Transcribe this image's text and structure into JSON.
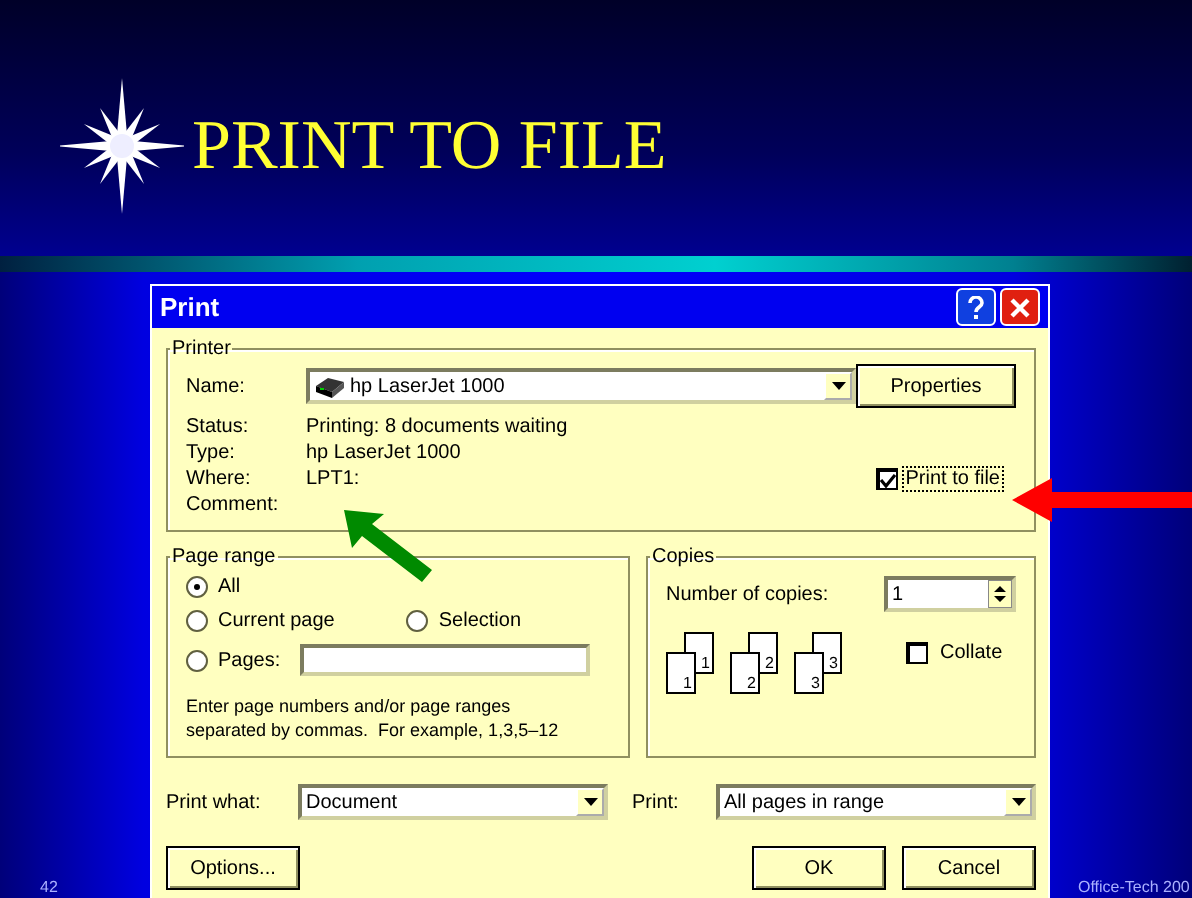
{
  "slide": {
    "title": "PRINT TO FILE",
    "number": "42",
    "footer": "Office-Tech 200"
  },
  "dialog": {
    "title": "Print",
    "printer": {
      "legend": "Printer",
      "name_label": "Name:",
      "name_value": "hp LaserJet 1000",
      "properties_button": "Properties",
      "info": [
        {
          "label": "Status:",
          "value": "Printing: 8 documents waiting"
        },
        {
          "label": "Type:",
          "value": "hp LaserJet 1000"
        },
        {
          "label": "Where:",
          "value": "LPT1:"
        },
        {
          "label": "Comment:"
        }
      ],
      "print_to_file": {
        "label": "Print to file",
        "checked": true
      }
    },
    "page_range": {
      "legend": "Page range",
      "options": [
        {
          "label": "All",
          "selected": true
        },
        {
          "label": "Current page",
          "selected": false
        },
        {
          "label": "Selection",
          "selected": false
        },
        {
          "label": "Pages:",
          "selected": false
        }
      ],
      "hint": "Enter page numbers and/or page ranges\nseparated by commas.  For example, 1,3,5–12"
    },
    "copies": {
      "legend": "Copies",
      "count_label": "Number of copies:",
      "count_value": "1",
      "stacks": [
        {
          "back": "1",
          "front": "1"
        },
        {
          "back": "2",
          "front": "2"
        },
        {
          "back": "3",
          "front": "3"
        }
      ],
      "collate": {
        "label": "Collate",
        "checked": false
      }
    },
    "print_what": {
      "label": "Print what:",
      "value": "Document"
    },
    "print": {
      "label": "Print:",
      "value": "All pages in range"
    },
    "buttons": {
      "options": "Options...",
      "ok": "OK",
      "cancel": "Cancel"
    }
  }
}
